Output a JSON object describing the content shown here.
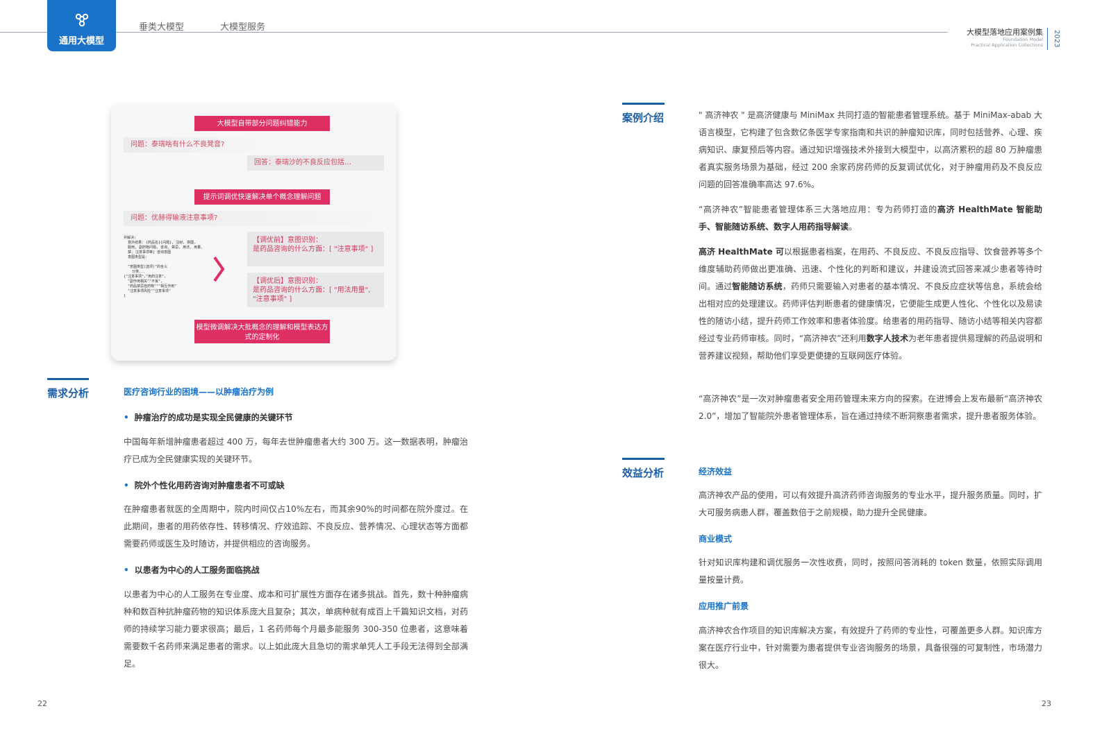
{
  "header": {
    "category": "通用大模型",
    "nav": [
      "垂类大模型",
      "大模型服务"
    ],
    "book_title": "大模型落地应用案例集",
    "book_en_1": "Foundation Model",
    "book_en_2": "Practical Application Collections",
    "year": "2023"
  },
  "figure": {
    "box1": "大模型自带部分问题纠错能力",
    "q1": "问题：泰瑞啥有什么不良凳音?",
    "a1": "回答：泰瑞沙的不良反应包括…",
    "box2": "提示词调优快速解决单个概念理解问题",
    "q2": "问题：优赫得输液注意事项?",
    "code": "并解决:\n  意外结果: {药品名}{问题}, 注射, 意图,\n  服用, 副药物问题, 咨询, 禁忌, 用法, 用量,\n  禁, 注意事项等] 咨询意图\n  意图类型是:\n\n  \"意图类型(选项)\"的含义\n    分类...\n{\"注意事项\",\"用药注意\",\n  \"副作用相关\"\"不良\",\n  \"药品禁忌症药物\"\"\"相互作用\"\n  \"注意事项风险\"\"注意事项\"\n}",
    "before_label": "【调优前】意图识别：",
    "before_text": "是药品咨询的什么方面：[ \"注意事项\" ]",
    "after_label": "【调优后】意图识别：",
    "after_text": "是药品咨询的什么方面：[ \"用法用量\", \"注意事项\" ]",
    "box3": "模型微调解决大批概念的理解和模型表达方式的定制化"
  },
  "left": {
    "section_title": "需求分析",
    "subhead": "医疗咨询行业的困境——以肿瘤治疗为例",
    "bullet1": "肿瘤治疗的成功是实现全民健康的关键环节",
    "para1": "中国每年新增肿瘤患者超过 400 万，每年去世肿瘤患者大约 300 万。这一数据表明，肿瘤治疗已成为全民健康实现的关键环节。",
    "bullet2": "院外个性化用药咨询对肿瘤患者不可或缺",
    "para2": "在肿瘤患者就医的全周期中，院内时间仅占10%左右，而其余90%的时间都在院外度过。在此期间，患者的用药依存性、转移情况、疗效追踪、不良反应、营养情况、心理状态等方面都需要药师或医生及时随访，并提供相应的咨询服务。",
    "bullet3": "以患者为中心的人工服务面临挑战",
    "para3": "以患者为中心的人工服务在专业度、成本和可扩展性方面存在诸多挑战。首先，数十种肿瘤病种和数百种抗肿瘤药物的知识体系庞大且复杂；其次，单病种就有成百上千篇知识文档，对药师的持续学习能力要求很高；最后，1 名药师每个月最多能服务 300-350 位患者，这意味着需要数千名药师来满足患者的需求。以上如此庞大且急切的需求单凭人工手段无法得到全部满足。"
  },
  "right": {
    "case_title": "案例介绍",
    "case_p1": "\" 高济神农 \" 是高济健康与 MiniMax 共同打造的智能患者管理系统。基于 MiniMax-abab 大语言模型，它构建了包含数亿条医学专家指南和共识的肿瘤知识库，同时包括营养、心理、疾病知识、康复预后等内容。通过知识增强技术外接到大模型中，以高济累积的超 80 万肿瘤患者真实服务场景为基础，经过 200 余家药房药师的反复调试优化，对于肿瘤用药及不良反应问题的回答准确率高达 97.6%。",
    "case_p2_a": "“高济神农”智能患者管理体系三大落地应用：专为药师打造的",
    "case_p2_b": "高济 HealthMate 智能助手、智能随访系统、数字人用药指导解读",
    "case_p2_c": "。",
    "case_p3_a": "高济 HealthMate 可",
    "case_p3_b": "以根据患者档案，在用药、不良反应、不良反应指导、饮食营养等多个维度辅助药师做出更准确、迅速、个性化的判断和建议，并建设流式回答来减少患者等待时间。通过",
    "case_p3_c": "智能随访系统",
    "case_p3_d": "，药师只需要输入对患者的基本情况、不良反应症状等信息，系统会给出相对应的处理建议。药师评估判断患者的健康情况，它便能生成更人性化、个性化以及易读性的随访小结，提升药师工作效率和患者体验度。给患者的用药指导、随访小结等相关内容都经过专业药师审核。同时，“高济神农”还利用",
    "case_p3_e": "数字人技术",
    "case_p3_f": "为老年患者提供易理解的药品说明和营养建议视频，帮助他们享受更便捷的互联网医疗体验。",
    "case_p4": "“高济神农”是一次对肿瘤患者安全用药管理未来方向的探索。在进博会上发布最新“高济神农 2.0”，增加了智能院外患者管理体系，旨在通过持续不断洞察患者需求，提升患者服务体验。",
    "benefit_title": "效益分析",
    "econ_head": "经济效益",
    "econ_p": "高济神农产品的使用，可以有效提升高济药师咨询服务的专业水平，提升服务质量。同时，扩大可服务病患人群，覆盖数倍于之前规模，助力提升全民健康。",
    "biz_head": "商业模式",
    "biz_p": "针对知识库构建和调优服务一次性收费，同时，按照问答消耗的 token 数量，依照实际调用量按量计费。",
    "promo_head": "应用推广前景",
    "promo_p": "高济神农合作项目的知识库解决方案，有效提升了药师的专业性，可覆盖更多人群。知识库方案在医疗行业中，针对需要为患者提供专业咨询服务的场景，具备很强的可复制性，市场潜力很大。"
  },
  "page_left": "22",
  "page_right": "23"
}
